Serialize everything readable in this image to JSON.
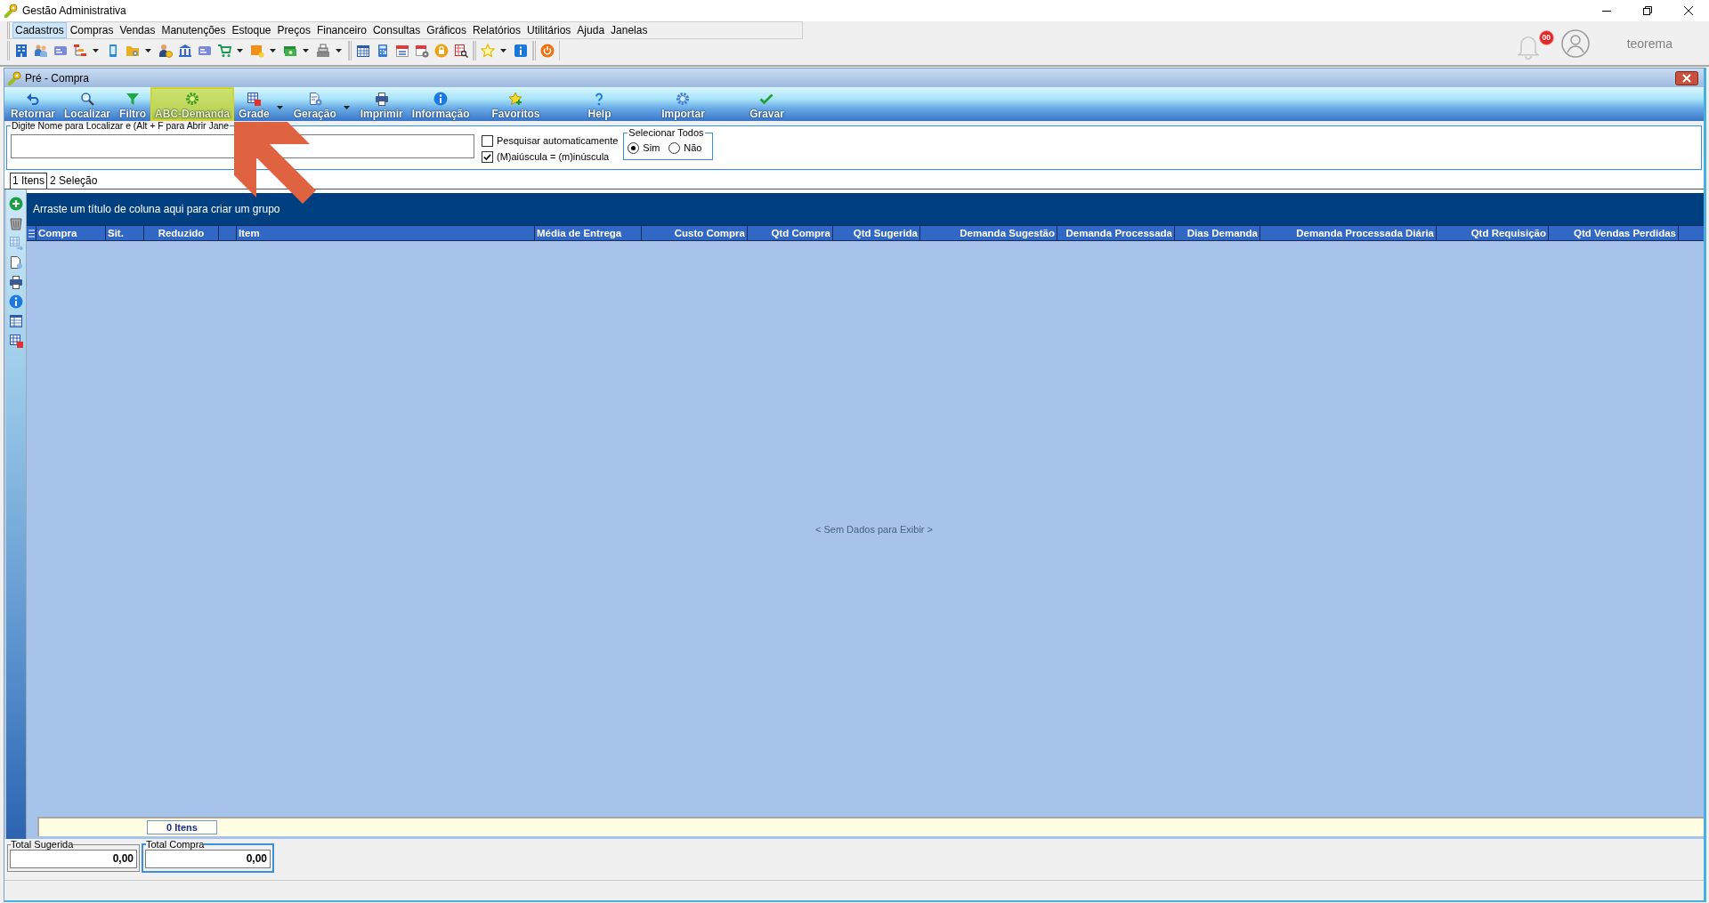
{
  "window": {
    "title": "Gestão Administrativa"
  },
  "menu_bar": [
    {
      "label": "Cadastros",
      "selected": true
    },
    {
      "label": "Compras",
      "selected": false
    },
    {
      "label": "Vendas",
      "selected": false
    },
    {
      "label": "Manutenções",
      "selected": false
    },
    {
      "label": "Estoque",
      "selected": false
    },
    {
      "label": "Preços",
      "selected": false
    },
    {
      "label": "Financeiro",
      "selected": false
    },
    {
      "label": "Consultas",
      "selected": false
    },
    {
      "label": "Gráficos",
      "selected": false
    },
    {
      "label": "Relatórios",
      "selected": false
    },
    {
      "label": "Utilitários",
      "selected": false
    },
    {
      "label": "Ajuda",
      "selected": false
    },
    {
      "label": "Janelas",
      "selected": false
    }
  ],
  "notifications": {
    "badge": "00"
  },
  "user": {
    "name": "teorema"
  },
  "document": {
    "title": "Pré - Compra",
    "toolbar": [
      {
        "label": "Retornar",
        "highlighted": false,
        "dropdown": false
      },
      {
        "label": "Localizar",
        "highlighted": false,
        "dropdown": false
      },
      {
        "label": "Filtro",
        "highlighted": false,
        "dropdown": false
      },
      {
        "label": "ABC-Demanda",
        "highlighted": true,
        "dropdown": false
      },
      {
        "label": "Grade",
        "highlighted": false,
        "dropdown": true
      },
      {
        "label": "Geração",
        "highlighted": false,
        "dropdown": true
      },
      {
        "label": "Imprimir",
        "highlighted": false,
        "dropdown": false
      },
      {
        "label": "Informação",
        "highlighted": false,
        "dropdown": false
      },
      {
        "label": "Favoritos",
        "highlighted": false,
        "dropdown": false
      },
      {
        "label": "Help",
        "highlighted": false,
        "dropdown": false
      },
      {
        "label": "Importar",
        "highlighted": false,
        "dropdown": false
      },
      {
        "label": "Gravar",
        "highlighted": false,
        "dropdown": false
      }
    ],
    "search": {
      "label": "Digite Nome para Localizar e (Alt + F para Abrir Jane"
    },
    "options": [
      {
        "label": "Pesquisar automaticamente",
        "checked": false
      },
      {
        "label": "(M)aiúscula = (m)inúscula",
        "checked": true
      }
    ],
    "select_all": {
      "title": "Selecionar Todos",
      "options": [
        {
          "label": "Sim",
          "selected": true
        },
        {
          "label": "Não",
          "selected": false
        }
      ]
    },
    "tabs": [
      {
        "label": "1 Itens",
        "selected": true
      },
      {
        "label": "2 Seleção",
        "selected": false
      }
    ],
    "side_tools": [
      {
        "disabled": false
      },
      {
        "disabled": false
      },
      {
        "disabled": true
      },
      {
        "disabled": false
      },
      {
        "disabled": false
      },
      {
        "disabled": false
      },
      {
        "disabled": false
      },
      {
        "disabled": false
      }
    ],
    "grid": {
      "group_hint": "Arraste um título de coluna aqui para criar um grupo",
      "columns": [
        {
          "label": "Compra",
          "kind": "text"
        },
        {
          "label": "Sit.",
          "kind": "text"
        },
        {
          "label": "Reduzido",
          "kind": "code"
        },
        {
          "kind": "blank"
        },
        {
          "label": "Item",
          "kind": "text"
        },
        {
          "label": "Média de Entrega",
          "kind": "text"
        },
        {
          "label": "Custo Compra",
          "kind": "number"
        },
        {
          "label": "Qtd Compra",
          "kind": "number"
        },
        {
          "label": "Qtd Sugerida",
          "kind": "number"
        },
        {
          "label": "Demanda Sugestão",
          "kind": "number"
        },
        {
          "label": "Demanda Processada",
          "kind": "number"
        },
        {
          "label": "Dias Demanda",
          "kind": "number"
        },
        {
          "label": "Demanda Processada Diária",
          "kind": "number"
        },
        {
          "label": "Qtd Requisição",
          "kind": "number"
        },
        {
          "label": "Qtd Vendas Perdidas",
          "kind": "number"
        }
      ],
      "empty_text": "< Sem Dados para Exibir >",
      "count": "0 Itens"
    },
    "totals": [
      {
        "label": "Total Sugerida",
        "value": "0,00",
        "focused": false
      },
      {
        "label": "Total Compra",
        "value": "0,00",
        "focused": true
      }
    ]
  }
}
